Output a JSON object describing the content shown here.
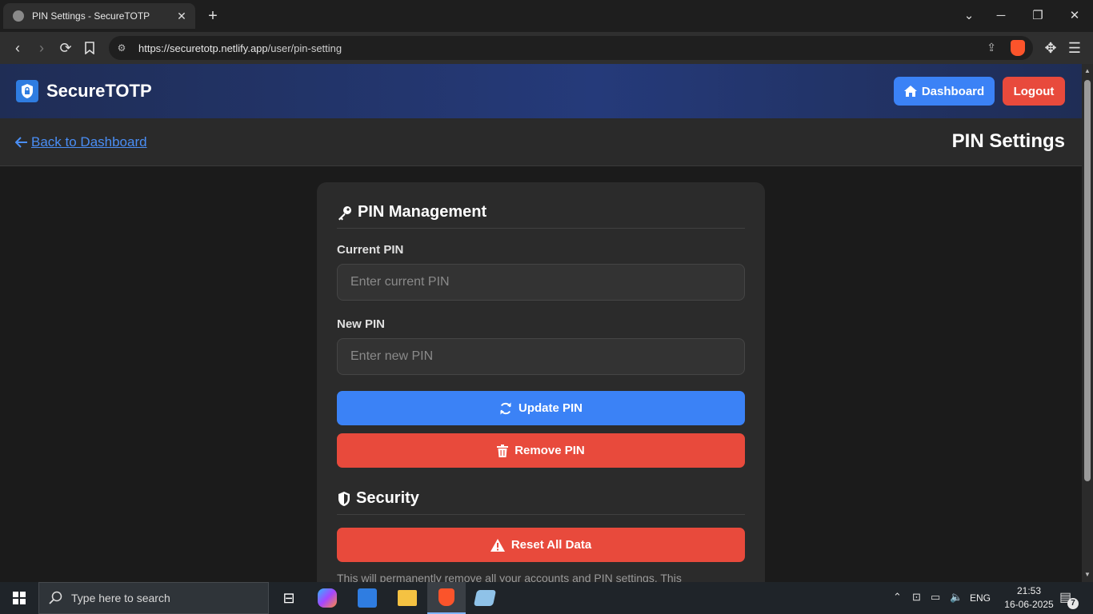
{
  "browser": {
    "tab_title": "PIN Settings - SecureTOTP",
    "new_tab_symbol": "+",
    "url_host": "https://securetotp.netlify.app",
    "url_path": "/user/pin-setting"
  },
  "header": {
    "brand": "SecureTOTP",
    "dashboard_label": "Dashboard",
    "logout_label": "Logout"
  },
  "subheader": {
    "back_label": "Back to Dashboard",
    "page_title": "PIN Settings"
  },
  "pin_management": {
    "title": "PIN Management",
    "current_pin_label": "Current PIN",
    "current_pin_placeholder": "Enter current PIN",
    "new_pin_label": "New PIN",
    "new_pin_placeholder": "Enter new PIN",
    "update_label": "Update PIN",
    "remove_label": "Remove PIN"
  },
  "security": {
    "title": "Security",
    "reset_label": "Reset All Data",
    "warning": "This will permanently remove all your accounts and PIN settings. This"
  },
  "taskbar": {
    "search_placeholder": "Type here to search",
    "language": "ENG",
    "time": "21:53",
    "date": "16-06-2025",
    "notification_count": "7"
  },
  "colors": {
    "primary_blue": "#3b82f6",
    "danger_red": "#e84a3c",
    "card_bg": "#2b2b2b",
    "page_bg": "#1b1b1b"
  }
}
